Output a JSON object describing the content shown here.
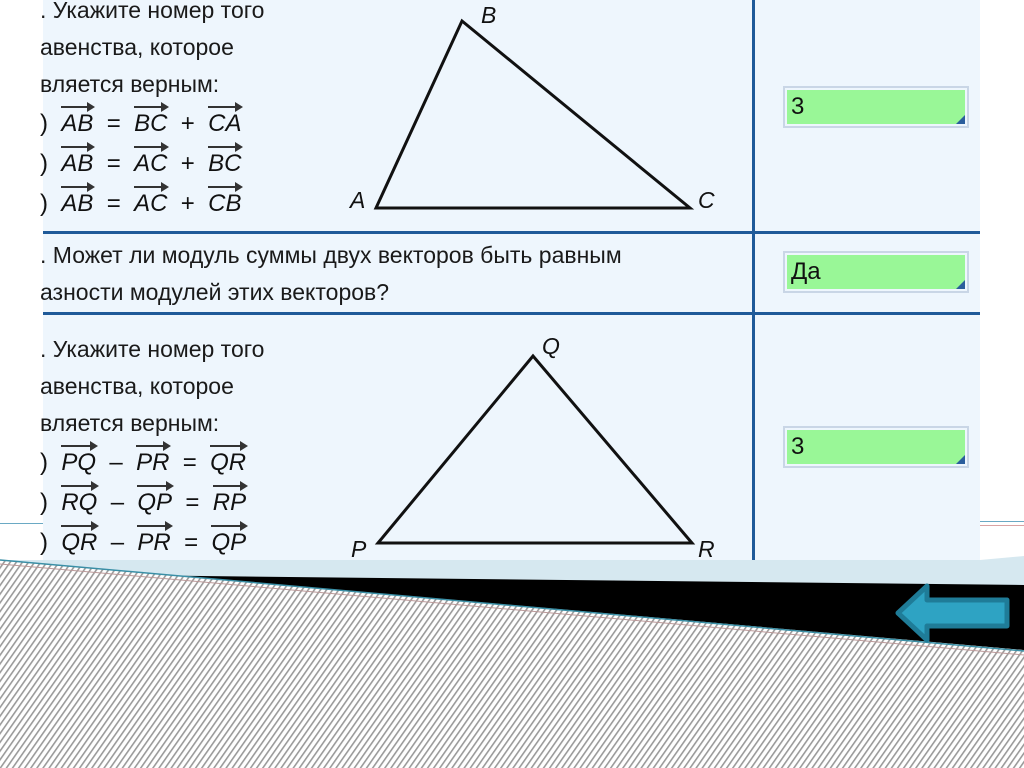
{
  "questions": [
    {
      "text_lines": [
        ". Укажите номер того",
        "авенства, которое",
        "вляется верным:"
      ],
      "options": [
        {
          "paren": ")",
          "a": "AB",
          "op1": "=",
          "b": "BC",
          "op2": "+",
          "c": "CA"
        },
        {
          "paren": ")",
          "a": "AB",
          "op1": "=",
          "b": "AC",
          "op2": "+",
          "c": "BC"
        },
        {
          "paren": ")",
          "a": "AB",
          "op1": "=",
          "b": "AC",
          "op2": "+",
          "c": "CB"
        }
      ],
      "figure": {
        "vertices": [
          "A",
          "B",
          "C"
        ]
      },
      "answer": "3"
    },
    {
      "text_lines": [
        ". Может ли модуль суммы двух векторов быть равным",
        "азности модулей этих векторов?"
      ],
      "answer": "Да"
    },
    {
      "text_lines": [
        ". Укажите номер того",
        "авенства, которое",
        "вляется верным:"
      ],
      "options": [
        {
          "paren": ")",
          "a": "PQ",
          "op1": "–",
          "b": "PR",
          "op2": "=",
          "c": "QR"
        },
        {
          "paren": ")",
          "a": "RQ",
          "op1": "–",
          "b": "QP",
          "op2": "=",
          "c": "RP"
        },
        {
          "paren": ")",
          "a": "QR",
          "op1": "–",
          "b": "PR",
          "op2": "=",
          "c": "QP"
        }
      ],
      "figure": {
        "vertices": [
          "P",
          "Q",
          "R"
        ]
      },
      "answer": "3"
    }
  ],
  "navigation": {
    "back_button": "back-arrow-icon"
  },
  "colors": {
    "panel_bg": "#eef6fd",
    "grid_line": "#1f5a99",
    "answer_bg": "#99f797",
    "arrow_fill": "#2ea3c3",
    "arrow_stroke": "#1f7c98"
  }
}
